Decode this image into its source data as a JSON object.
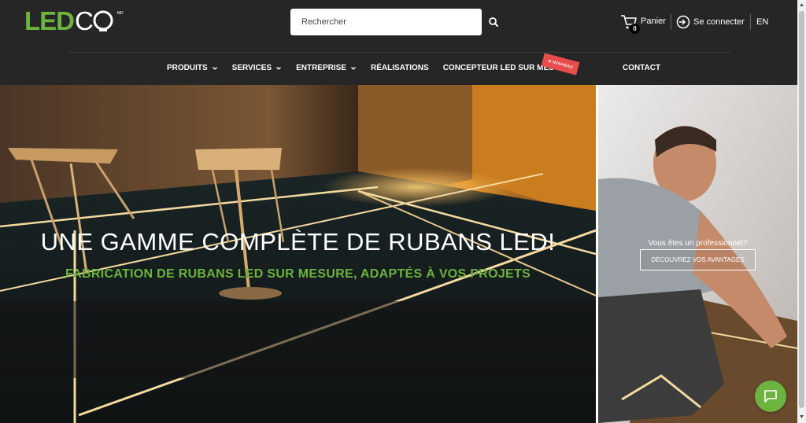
{
  "brand": {
    "logo_led": "LED",
    "logo_co": "CO",
    "logo_mark": "MD"
  },
  "search": {
    "placeholder": "Rechercher"
  },
  "cart": {
    "label": "Panier",
    "count": "0"
  },
  "login": {
    "label": "Se connecter"
  },
  "language": {
    "label": "EN"
  },
  "nav": {
    "items": [
      {
        "label": "PRODUITS",
        "has_dropdown": true
      },
      {
        "label": "SERVICES",
        "has_dropdown": true
      },
      {
        "label": "ENTREPRISE",
        "has_dropdown": true
      },
      {
        "label": "RÉALISATIONS",
        "has_dropdown": false
      },
      {
        "label": "CONCEPTEUR LED SUR MESURE",
        "has_dropdown": false
      },
      {
        "label": "CONTACT",
        "has_dropdown": false
      }
    ],
    "badge": "★ NOUVEAU"
  },
  "hero": {
    "title": "UNE GAMME COMPLÈTE DE RUBANS LED!",
    "subtitle": "FABRICATION DE RUBANS LED SUR MESURE, ADAPTÉS À VOS PROJETS"
  },
  "pro": {
    "question": "Vous êtes un professionnel?",
    "cta": "DÉCOUVREZ VOS AVANTAGES"
  },
  "colors": {
    "header_bg": "#262626",
    "brand_green": "#6db33f",
    "badge_red": "#e84c4c"
  },
  "icons": {
    "search": "search-icon",
    "cart": "cart-icon",
    "login": "login-icon",
    "chat": "chat-icon"
  }
}
